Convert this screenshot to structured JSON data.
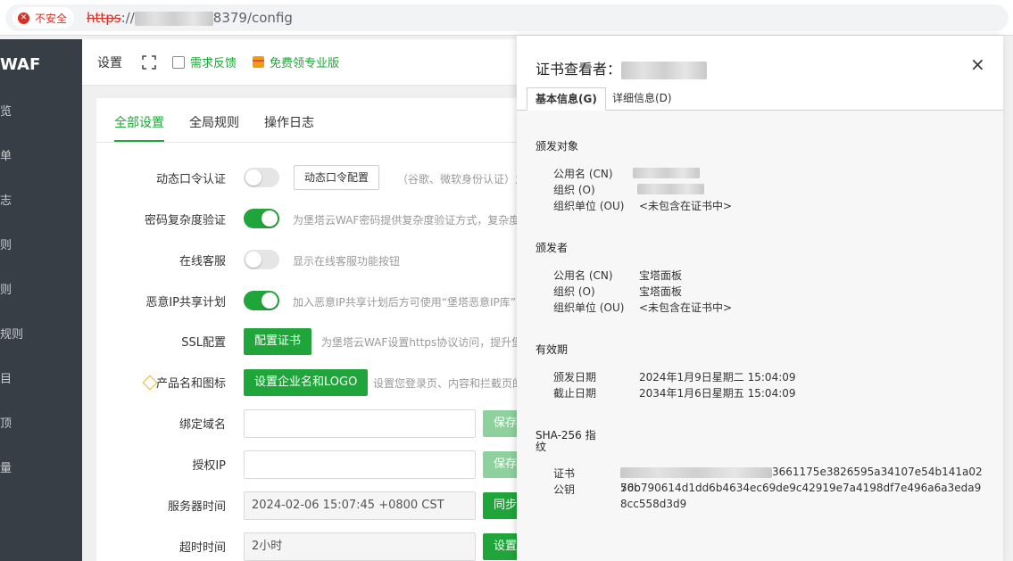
{
  "browser": {
    "security_label": "不安全",
    "url_scheme": "https",
    "url_rest": "8379/config"
  },
  "sidebar": {
    "brand": "WAF",
    "items": [
      "览",
      "单",
      "志",
      "则",
      "则",
      "规则",
      "目",
      "顶",
      "量"
    ]
  },
  "topnav": {
    "title": "设置",
    "feedback_label": "需求反馈",
    "pro_label": "免费领专业版"
  },
  "tabs": {
    "all_settings": "全部设置",
    "global_rules": "全局规则",
    "operation_log": "操作日志"
  },
  "settings": {
    "dynamic_otp_label": "动态口令认证",
    "dynamic_otp_button": "动态口令配置",
    "dynamic_otp_hint": "（谷歌、微软身份认证）为",
    "password_complexity_label": "密码复杂度验证",
    "password_complexity_hint": "为堡塔云WAF密码提供复杂度验证方式，复杂度",
    "online_service_label": "在线客服",
    "online_service_hint": "显示在线客服功能按钮",
    "malicious_ip_label": "恶意IP共享计划",
    "malicious_ip_hint": "加入恶意IP共享计划后方可使用“堡塔恶意IP库”",
    "ssl_label": "SSL配置",
    "ssl_button": "配置证书",
    "ssl_hint": "为堡塔云WAF设置https协议访问，提升堡",
    "product_label": "产品名和图标",
    "product_button": "设置企业名和LOGO",
    "product_hint": "设置您登录页、内容和拦截页的",
    "bind_domain_label": "绑定域名",
    "bind_domain_button": "保存",
    "auth_ip_label": "授权IP",
    "auth_ip_button": "保存",
    "server_time_label": "服务器时间",
    "server_time_value": "2024-02-06 15:07:45 +0800 CST",
    "server_time_button": "同步",
    "timeout_label": "超时时间",
    "timeout_value": "2小时",
    "timeout_button": "设置"
  },
  "cert_dialog": {
    "title": "证书查看者：",
    "close": "×",
    "tab_basic": "基本信息(G)",
    "tab_detail": "详细信息(D)",
    "issued_to_heading": "颁发对象",
    "issued_to": {
      "cn_label": "公用名 (CN)",
      "org_label": "组织 (O)",
      "ou_label": "组织单位 (OU)",
      "ou_value": "<未包含在证书中>"
    },
    "issuer_heading": "颁发者",
    "issuer": {
      "cn_label": "公用名 (CN)",
      "cn_value": "宝塔面板",
      "org_label": "组织 (O)",
      "org_value": "宝塔面板",
      "ou_label": "组织单位 (OU)",
      "ou_value": "<未包含在证书中>"
    },
    "validity_heading": "有效期",
    "validity": {
      "issued_label": "颁发日期",
      "issued_value": "2024年1月9日星期二 15:04:09",
      "expires_label": "截止日期",
      "expires_value": "2034年1月6日星期五 15:04:09"
    },
    "sha_heading_line1": "SHA-256 指",
    "sha_heading_line2": "纹",
    "fingerprint": {
      "cert_label": "证书",
      "cert_value_visible": "3661175e3826595a34107e54b141a0256c",
      "pubkey_label": "公钥",
      "pubkey_value": "70b790614d1dd6b4634ec69de9c42919e7a4198df7e496a6a3eda98cc558d3d9"
    }
  }
}
